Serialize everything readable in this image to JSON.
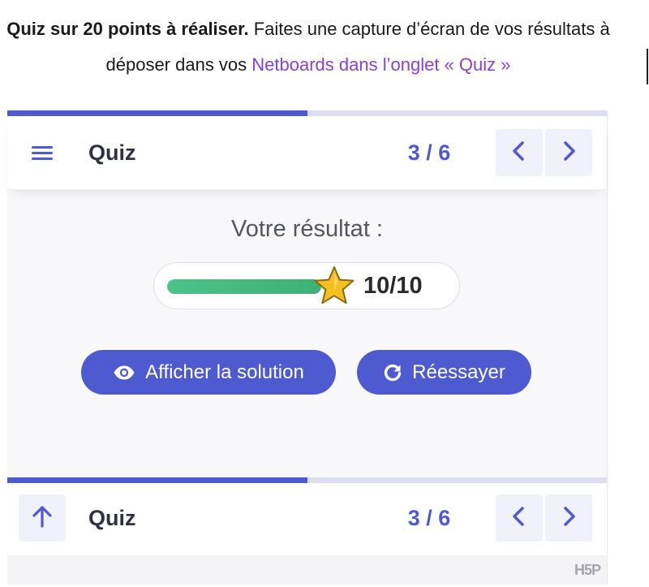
{
  "intro": {
    "bold": "Quiz sur 20 points à réaliser.",
    "text": " Faites une capture d’écran de vos résultats à déposer dans vos ",
    "link": "Netboards dans l’onglet « Quiz »"
  },
  "quiz": {
    "progress_fraction": 0.5,
    "top_bar": {
      "menu_icon": "hamburger-menu-icon",
      "title": "Quiz",
      "counter": "3 / 6"
    },
    "result": {
      "title": "Votre résultat :",
      "score_text": "10/10",
      "score_fraction": 1.0,
      "star_icon": "star-icon"
    },
    "buttons": {
      "show_solution": "Afficher la solution",
      "show_solution_icon": "eye-icon",
      "retry": "Réessayer",
      "retry_icon": "retry-icon"
    },
    "bottom_bar": {
      "scroll_icon": "arrow-up-icon",
      "title": "Quiz",
      "counter": "3 / 6"
    },
    "footer": {
      "logo": "H5P"
    }
  },
  "colors": {
    "accent": "#4d5ad0",
    "link": "#8a3fd6",
    "score_bar": "#4cc289",
    "star": "#f5c021"
  }
}
